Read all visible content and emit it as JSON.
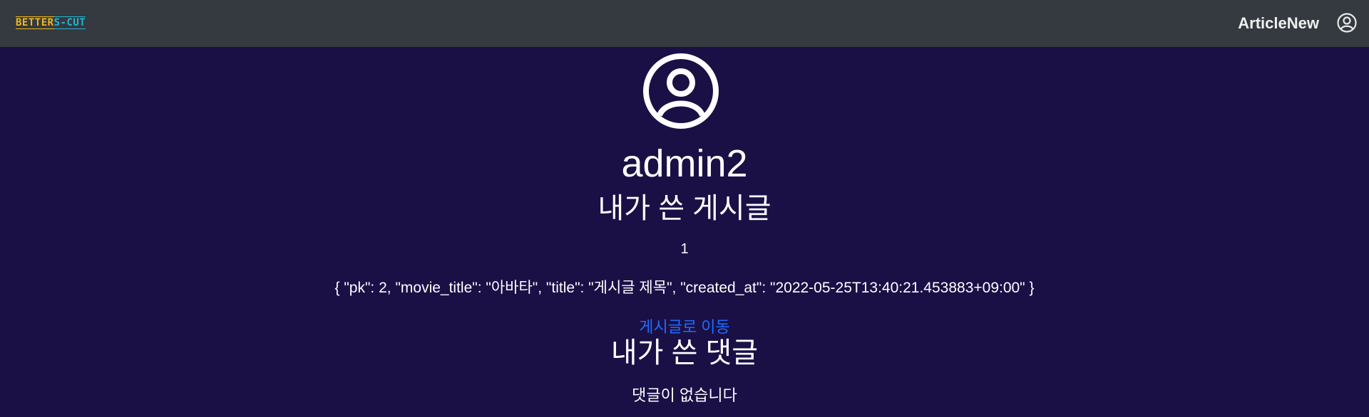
{
  "navbar": {
    "logo": {
      "part1": "BETTER",
      "part2": "S-CUT"
    },
    "link_label": "ArticleNew",
    "profile_icon": "user-circle-icon"
  },
  "profile": {
    "avatar_icon": "user-circle-icon",
    "username": "admin2"
  },
  "articles_section": {
    "heading": "내가 쓴 게시글",
    "count": "1",
    "items": [
      {
        "json_text": "{ \"pk\": 2, \"movie_title\": \"아바타\", \"title\": \"게시글 제목\", \"created_at\": \"2022-05-25T13:40:21.453883+09:00\" }",
        "link_label": "게시글로 이동"
      }
    ]
  },
  "comments_section": {
    "heading": "내가 쓴 댓글",
    "empty_message": "댓글이 없습니다"
  },
  "colors": {
    "navbar_bg": "#343a40",
    "page_bg": "#1a1046",
    "link": "#1f6bff",
    "logo_yellow": "#f2b61c",
    "logo_cyan": "#22b6d2"
  }
}
